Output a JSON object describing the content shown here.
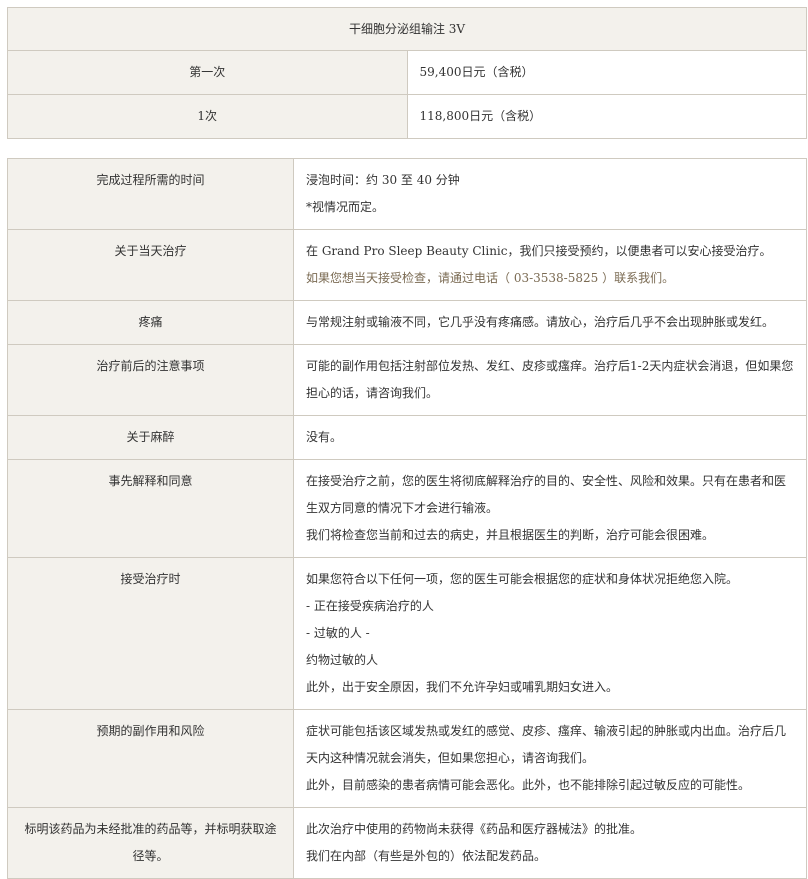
{
  "price_table": {
    "title": "干细胞分泌组输注 3V",
    "rows": [
      {
        "label": "第一次",
        "value": "59,400日元（含税）"
      },
      {
        "label": "1次",
        "value": "118,800日元（含税）"
      }
    ]
  },
  "info_table": {
    "rows": [
      {
        "label": "完成过程所需的时间",
        "lines": [
          "浸泡时间：约 30 至 40 分钟",
          "*视情况而定。"
        ]
      },
      {
        "label": "关于当天治疗",
        "lines": [
          "在 Grand Pro Sleep Beauty Clinic，我们只接受预约，以便患者可以安心接受治疗。",
          "如果您想当天接受检查，请通过电话（ 03-3538-5825 ）联系我们。"
        ]
      },
      {
        "label": "疼痛",
        "lines": [
          "与常规注射或输液不同，它几乎没有疼痛感。请放心，治疗后几乎不会出现肿胀或发红。"
        ]
      },
      {
        "label": "治疗前后的注意事项",
        "lines": [
          "可能的副作用包括注射部位发热、发红、皮疹或瘙痒。治疗后1-2天内症状会消退，但如果您担心的话，请咨询我们。"
        ]
      },
      {
        "label": "关于麻醉",
        "lines": [
          "没有。"
        ]
      },
      {
        "label": "事先解释和同意",
        "lines": [
          "在接受治疗之前，您的医生将彻底解释治疗的目的、安全性、风险和效果。只有在患者和医生双方同意的情况下才会进行输液。",
          "我们将检查您当前和过去的病史，并且根据医生的判断，治疗可能会很困难。"
        ]
      },
      {
        "label": "接受治疗时",
        "lines": [
          "如果您符合以下任何一项，您的医生可能会根据您的症状和身体状况拒绝您入院。",
          "- 正在接受疾病治疗的人",
          "- 过敏的人 -",
          "约物过敏的人",
          "此外，出于安全原因，我们不允许孕妇或哺乳期妇女进入。"
        ]
      },
      {
        "label": "预期的副作用和风险",
        "lines": [
          "症状可能包括该区域发热或发红的感觉、皮疹、瘙痒、输液引起的肿胀或内出血。治疗后几天内这种情况就会消失，但如果您担心，请咨询我们。",
          "此外，目前感染的患者病情可能会恶化。此外，也不能排除引起过敏反应的可能性。"
        ]
      },
      {
        "label": "标明该药品为未经批准的药品等，并标明获取途径等。",
        "lines": [
          "此次治疗中使用的药物尚未获得《药品和医疗器械法》的批准。",
          "我们在内部（有些是外包的）依法配发药品。"
        ]
      }
    ]
  }
}
